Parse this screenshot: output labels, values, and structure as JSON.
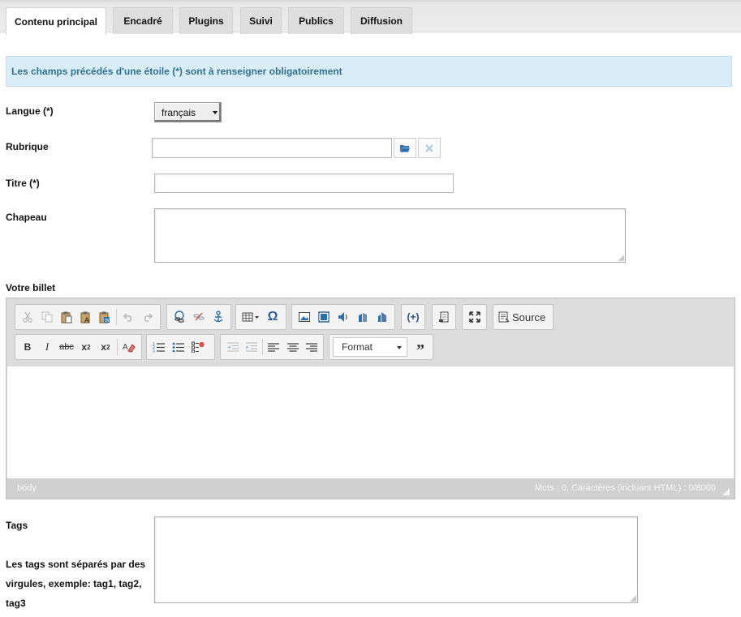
{
  "tabs": [
    {
      "label": "Contenu principal",
      "active": true
    },
    {
      "label": "Encadré"
    },
    {
      "label": "Plugins"
    },
    {
      "label": "Suivi"
    },
    {
      "label": "Publics"
    },
    {
      "label": "Diffusion"
    }
  ],
  "info_message": "Les champs précédés d'une étoile (*) sont à renseigner obligatoirement",
  "form": {
    "langue_label": "Langue  (*)",
    "langue_value": "français",
    "rubrique_label": "Rubrique",
    "rubrique_value": "",
    "titre_label": "Titre (*)",
    "titre_value": "",
    "chapeau_label": "Chapeau",
    "chapeau_value": "",
    "billet_label": "Votre billet",
    "tags_label": "Tags",
    "tags_help": "Les tags sont séparés par des virgules, exemple: tag1, tag2, tag3",
    "tags_value": ""
  },
  "editor": {
    "source_label": "Source",
    "format_label": "Format",
    "status_path": "body",
    "status_count": "Mots : 0, Caractères (incluant HTML) : 0/8000",
    "icons": [
      "cut-icon",
      "copy-icon",
      "paste-icon",
      "paste-text-icon",
      "paste-word-icon",
      "undo-icon",
      "redo-icon",
      "link-icon",
      "unlink-icon",
      "anchor-icon",
      "table-icon",
      "special-char-icon",
      "image-icon",
      "video-icon",
      "audio-icon",
      "chart-icon",
      "chart-alt-icon",
      "plugin-icon",
      "template-icon",
      "maximize-icon",
      "source-icon",
      "bold-icon",
      "italic-icon",
      "strikethrough-icon",
      "subscript-icon",
      "superscript-icon",
      "remove-format-icon",
      "numbered-list-icon",
      "bullet-list-icon",
      "checklist-icon",
      "outdent-icon",
      "indent-icon",
      "align-left-icon",
      "align-center-icon",
      "align-right-icon",
      "blockquote-icon"
    ]
  },
  "colors": {
    "info_bg": "#d9edf7",
    "info_text": "#31708f",
    "accent_blue": "#2a6fb0"
  }
}
